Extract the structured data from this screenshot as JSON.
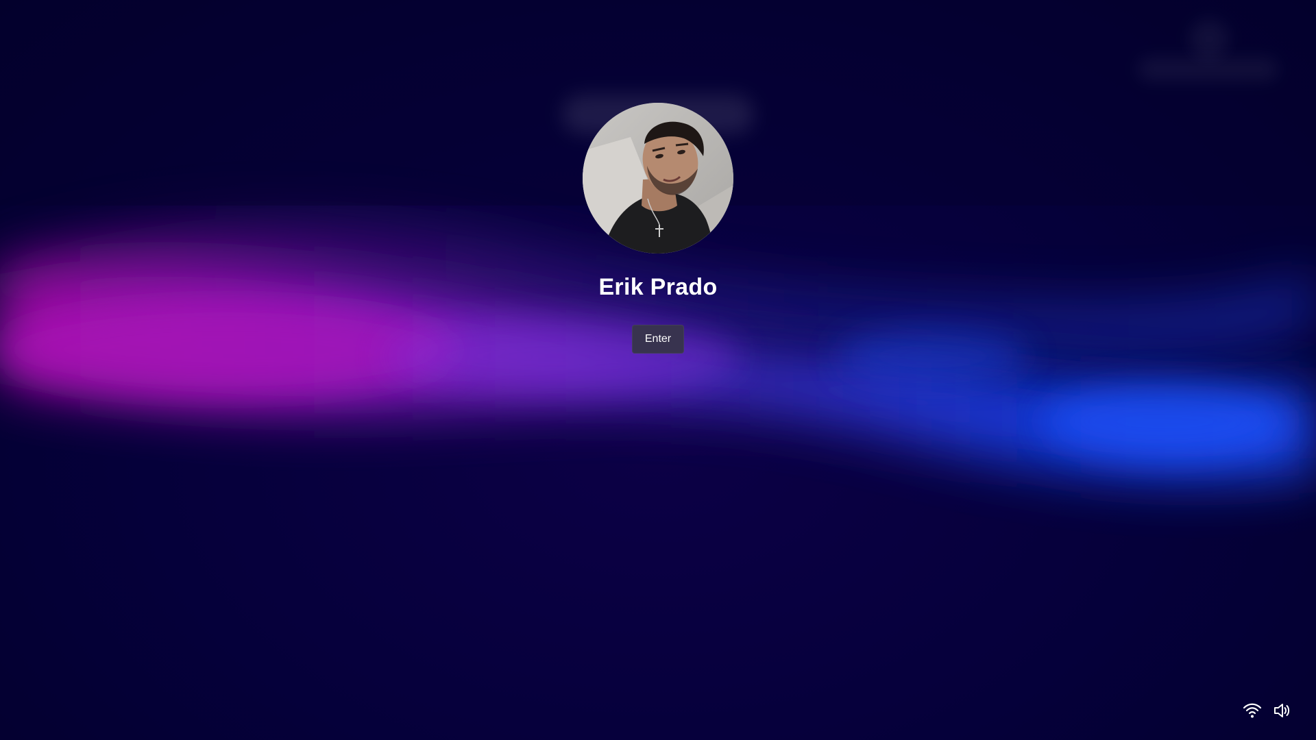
{
  "lock_screen": {
    "user": {
      "display_name": "Erik Prado",
      "avatar_icon": "user-photo"
    },
    "enter_label": "Enter"
  },
  "system_tray": {
    "items": [
      {
        "icon": "wifi-icon"
      },
      {
        "icon": "volume-icon"
      }
    ]
  },
  "theme": {
    "background": "#05003a",
    "wave_magenta": "#a010b8",
    "wave_purple": "#7a2ad0",
    "wave_blue": "#1a4ef0",
    "button_bg": "#38334f",
    "text": "#ffffff"
  }
}
